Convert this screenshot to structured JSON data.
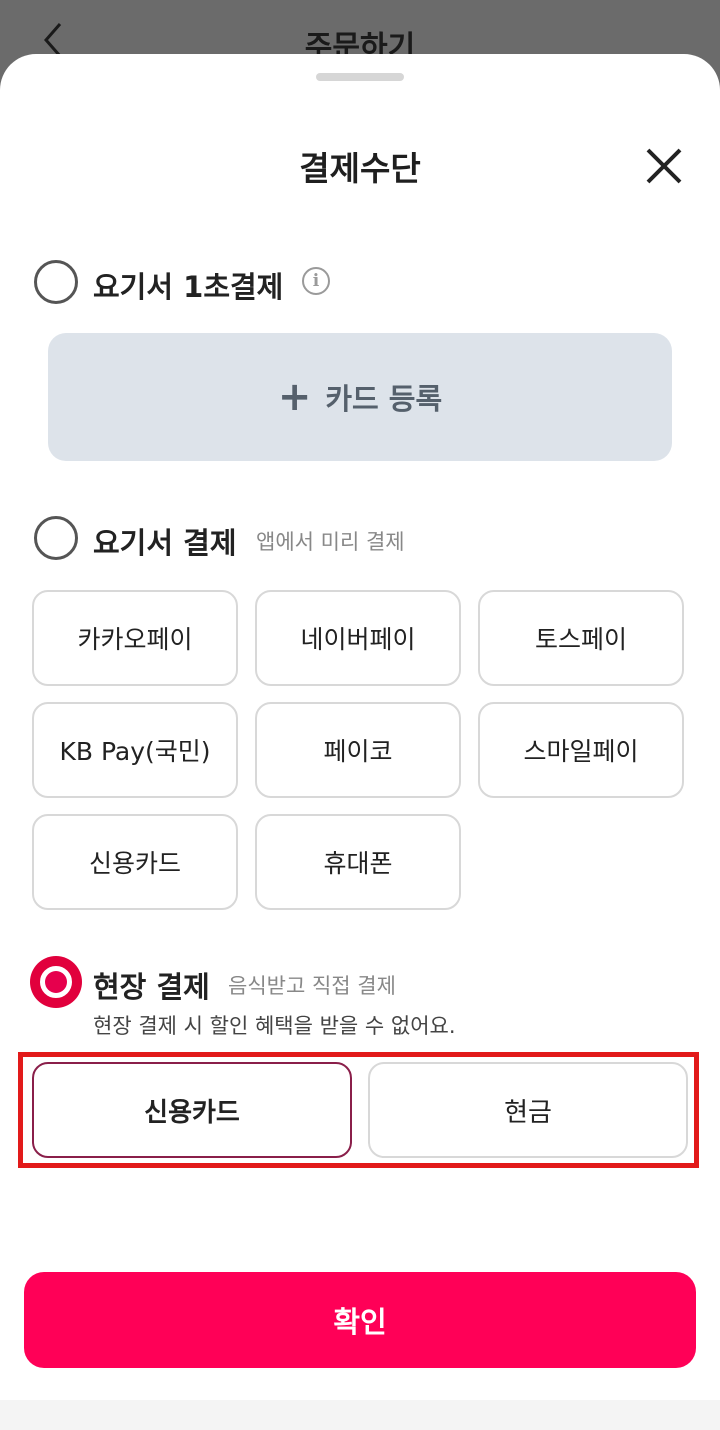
{
  "background_page": {
    "title": "주문하기",
    "back_icon": "chevron-left-icon"
  },
  "sheet": {
    "title": "결제수단",
    "close_icon": "close-icon"
  },
  "options": {
    "quick_pay": {
      "label": "요기서 1초결제",
      "info_icon": "info-icon",
      "info_glyph": "i",
      "selected": false
    },
    "card_register": {
      "plus_glyph": "+",
      "label": "카드 등록"
    },
    "app_pay": {
      "label": "요기서 결제",
      "sub": "앱에서 미리 결제",
      "selected": false,
      "methods": [
        "카카오페이",
        "네이버페이",
        "토스페이",
        "KB Pay(국민)",
        "페이코",
        "스마일페이",
        "신용카드",
        "휴대폰"
      ]
    },
    "onsite_pay": {
      "label": "현장 결제",
      "sub": "음식받고 직접 결제",
      "notice": "현장 결제 시 할인 혜택을 받을 수 없어요.",
      "selected": true,
      "methods": [
        "신용카드",
        "현금"
      ],
      "active_method": "신용카드"
    }
  },
  "confirm_button": {
    "label": "확인"
  },
  "colors": {
    "accent": "#ff0057",
    "selected_radio": "#e6004d",
    "highlight": "#e21a1a",
    "card_register_bg": "#dde3ea"
  }
}
